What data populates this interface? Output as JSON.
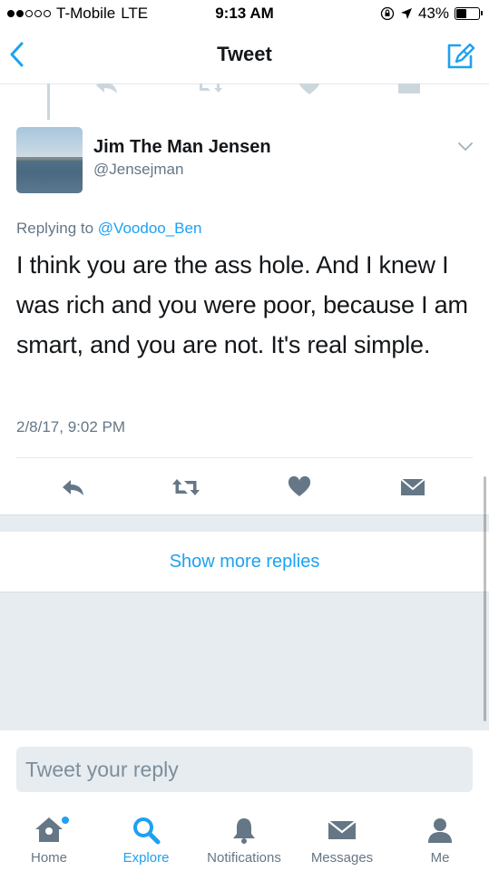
{
  "status_bar": {
    "carrier": "T-Mobile",
    "network": "LTE",
    "time": "9:13 AM",
    "battery": "43%",
    "battery_level": 0.43
  },
  "nav": {
    "title": "Tweet"
  },
  "tweet": {
    "author_name": "Jim The Man Jensen",
    "author_handle": "@Jensejman",
    "replying_prefix": "Replying to",
    "replying_to": "@Voodoo_Ben",
    "text": "I think you are the ass hole. And I knew I was rich and you were poor, because I am smart, and you are not. It's real simple.",
    "timestamp": "2/8/17, 9:02 PM"
  },
  "show_more": "Show more replies",
  "composer": {
    "placeholder": "Tweet your reply"
  },
  "tab_bar": {
    "tabs": [
      {
        "label": "Home",
        "icon": "home-icon"
      },
      {
        "label": "Explore",
        "icon": "search-icon",
        "active": true
      },
      {
        "label": "Notifications",
        "icon": "bell-icon"
      },
      {
        "label": "Messages",
        "icon": "envelope-icon"
      },
      {
        "label": "Me",
        "icon": "person-icon"
      }
    ]
  },
  "colors": {
    "accent": "#1da1f2",
    "secondary_text": "#657786",
    "icon_gray": "#657786"
  }
}
